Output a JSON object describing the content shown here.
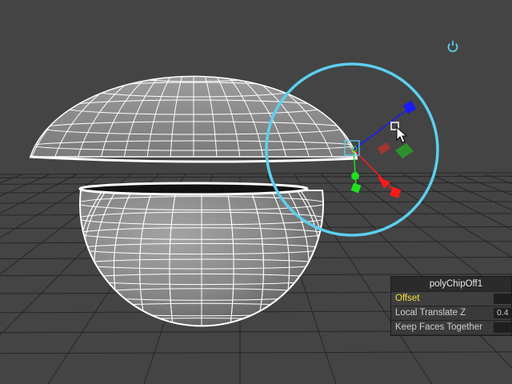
{
  "viewport": {
    "name": "maya-perspective-viewport",
    "background_color": "#444444",
    "grid_color": "#262626",
    "mesh_color": "#ffffff",
    "selection_circle_color": "#5ccfee",
    "gizmo_colors": {
      "x": "#ff1a1a",
      "y": "#1fe01f",
      "z": "#1a1aff"
    }
  },
  "icons": {
    "power_icon": "power-icon",
    "cursor_icon": "mouse-pointer-icon"
  },
  "hud": {
    "title": "polyChipOff1",
    "rows": [
      {
        "label": "Offset",
        "value": "",
        "highlight": true
      },
      {
        "label": "Local Translate Z",
        "value": "0.4"
      },
      {
        "label": "Keep Faces Together",
        "value": ""
      }
    ]
  }
}
